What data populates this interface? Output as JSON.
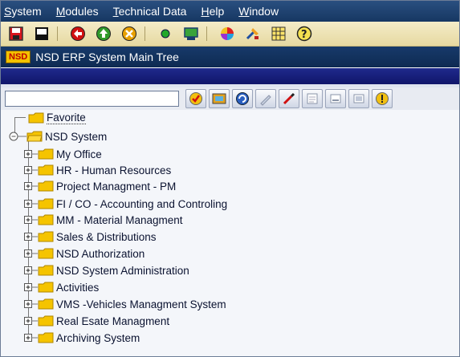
{
  "menubar": {
    "items": [
      {
        "label": "System"
      },
      {
        "label": "Modules"
      },
      {
        "label": "Technical Data"
      },
      {
        "label": "Help"
      },
      {
        "label": "Window"
      }
    ]
  },
  "system_toolbar": {
    "icons": [
      "save-icon",
      "new-document-icon",
      "back-icon",
      "exit-icon",
      "cancel-icon",
      "status-dot-icon",
      "print-icon",
      "color-palette-icon",
      "tools-icon",
      "layout-icon",
      "help-icon"
    ]
  },
  "titlebar": {
    "logo": "NSD",
    "title": "NSD ERP System Main Tree"
  },
  "command_field": {
    "value": "",
    "placeholder": ""
  },
  "app_toolbar": {
    "icons": [
      "check-icon",
      "display-icon",
      "refresh-icon",
      "edit-icon",
      "pencil-icon",
      "page-icon",
      "minimize-icon",
      "maximize-icon",
      "warning-icon"
    ]
  },
  "tree": {
    "favorite": "Favorite",
    "root": "NSD  System",
    "children": [
      "My Office",
      "HR - Human Resources",
      "Project Managment - PM",
      "FI / CO - Accounting and Controling",
      "MM - Material Managment",
      "Sales & Distributions",
      "NSD Authorization",
      "NSD System Administration",
      "Activities",
      "VMS -Vehicles Managment System",
      "Real  Esate Managment",
      "Archiving System"
    ]
  },
  "colors": {
    "menubar": "#163762",
    "toolbar": "#e6d9a1",
    "band": "#10166a",
    "folder": "#f5c400"
  }
}
